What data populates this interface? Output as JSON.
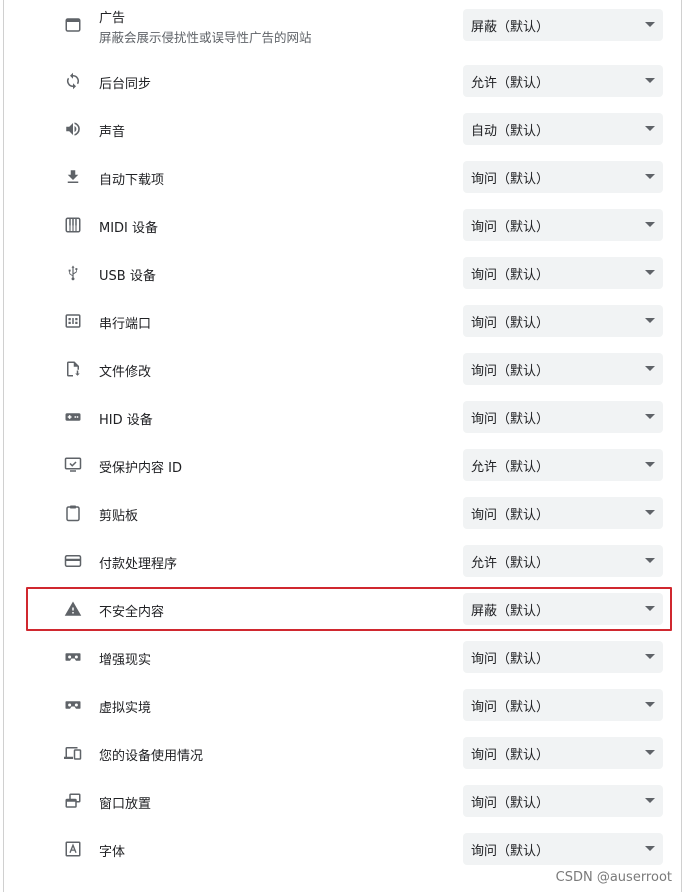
{
  "rows": [
    {
      "label": "广告",
      "sub": "屏蔽会展示侵扰性或误导性广告的网站",
      "value": "屏蔽（默认）",
      "icon": "ad-window-icon"
    },
    {
      "label": "后台同步",
      "value": "允许（默认）",
      "icon": "sync-icon"
    },
    {
      "label": "声音",
      "value": "自动（默认）",
      "icon": "volume-icon"
    },
    {
      "label": "自动下载项",
      "value": "询问（默认）",
      "icon": "download-icon"
    },
    {
      "label": "MIDI 设备",
      "value": "询问（默认）",
      "icon": "piano-icon"
    },
    {
      "label": "USB 设备",
      "value": "询问（默认）",
      "icon": "usb-icon"
    },
    {
      "label": "串行端口",
      "value": "询问（默认）",
      "icon": "serial-port-icon"
    },
    {
      "label": "文件修改",
      "value": "询问（默认）",
      "icon": "file-save-icon"
    },
    {
      "label": "HID 设备",
      "value": "询问（默认）",
      "icon": "gamepad-icon"
    },
    {
      "label": "受保护内容 ID",
      "value": "允许（默认）",
      "icon": "protected-content-icon"
    },
    {
      "label": "剪贴板",
      "value": "询问（默认）",
      "icon": "clipboard-icon"
    },
    {
      "label": "付款处理程序",
      "value": "允许（默认）",
      "icon": "credit-card-icon"
    },
    {
      "label": "不安全内容",
      "value": "屏蔽（默认）",
      "icon": "warning-icon"
    },
    {
      "label": "增强现实",
      "value": "询问（默认）",
      "icon": "vr-headset-icon"
    },
    {
      "label": "虚拟实境",
      "value": "询问（默认）",
      "icon": "vr-headset-icon"
    },
    {
      "label": "您的设备使用情况",
      "value": "询问（默认）",
      "icon": "devices-icon"
    },
    {
      "label": "窗口放置",
      "value": "询问（默认）",
      "icon": "window-placement-icon"
    },
    {
      "label": "字体",
      "value": "询问（默认）",
      "icon": "font-icon"
    }
  ],
  "watermark": "CSDN @auserroot",
  "colors": {
    "highlight": "#d0282f",
    "select_bg": "#f1f3f4",
    "icon": "#5f6368"
  }
}
